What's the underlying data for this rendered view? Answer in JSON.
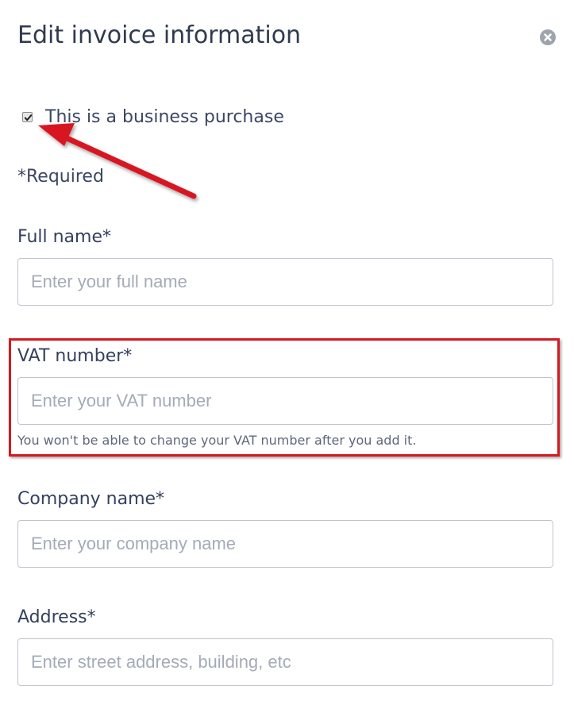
{
  "dialog": {
    "title": "Edit invoice information",
    "close_icon": "close-circle-icon"
  },
  "business_purchase": {
    "label": "This is a business purchase",
    "checked": true
  },
  "required_note": "*Required",
  "fields": {
    "full_name": {
      "label": "Full name*",
      "placeholder": "Enter your full name",
      "value": ""
    },
    "vat_number": {
      "label": "VAT number*",
      "placeholder": "Enter your VAT number",
      "value": "",
      "help": "You won't be able to change your VAT number after you add it."
    },
    "company_name": {
      "label": "Company name*",
      "placeholder": "Enter your company name",
      "value": ""
    },
    "address": {
      "label": "Address*",
      "placeholder": "Enter street address, building, etc",
      "value": ""
    }
  },
  "annotation": {
    "color": "#d81820"
  }
}
